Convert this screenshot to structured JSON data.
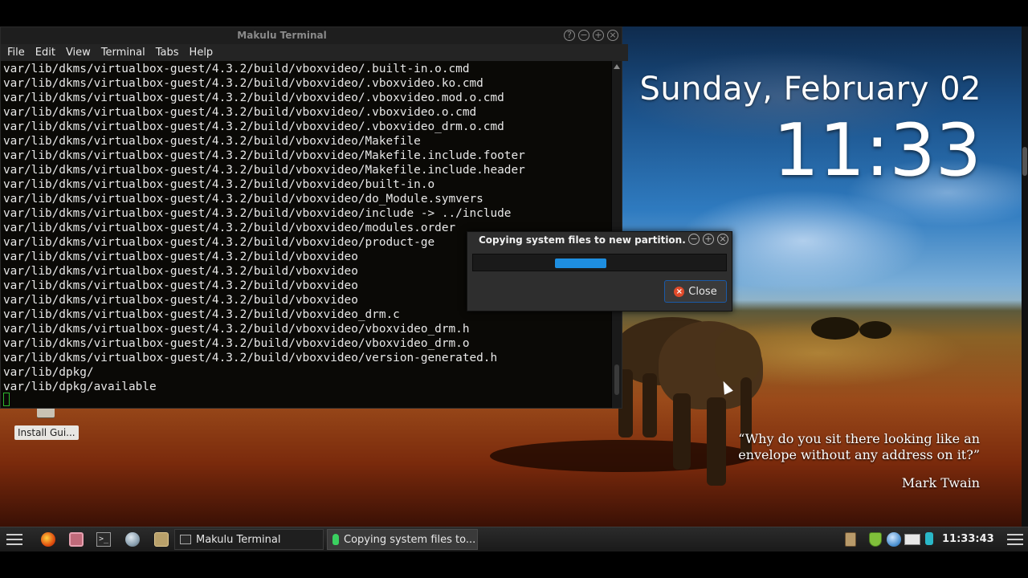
{
  "desktop": {
    "clock_date": "Sunday, February 02",
    "clock_time": "11:33",
    "quote_text": "“Why do you sit there looking like an envelope without any address on it?”",
    "quote_author": "Mark Twain",
    "icon_label": "Install Gui..."
  },
  "terminal": {
    "title": "Makulu Terminal",
    "menu": [
      "File",
      "Edit",
      "View",
      "Terminal",
      "Tabs",
      "Help"
    ],
    "lines": [
      "var/lib/dkms/virtualbox-guest/4.3.2/build/vboxvideo/.built-in.o.cmd",
      "var/lib/dkms/virtualbox-guest/4.3.2/build/vboxvideo/.vboxvideo.ko.cmd",
      "var/lib/dkms/virtualbox-guest/4.3.2/build/vboxvideo/.vboxvideo.mod.o.cmd",
      "var/lib/dkms/virtualbox-guest/4.3.2/build/vboxvideo/.vboxvideo.o.cmd",
      "var/lib/dkms/virtualbox-guest/4.3.2/build/vboxvideo/.vboxvideo_drm.o.cmd",
      "var/lib/dkms/virtualbox-guest/4.3.2/build/vboxvideo/Makefile",
      "var/lib/dkms/virtualbox-guest/4.3.2/build/vboxvideo/Makefile.include.footer",
      "var/lib/dkms/virtualbox-guest/4.3.2/build/vboxvideo/Makefile.include.header",
      "var/lib/dkms/virtualbox-guest/4.3.2/build/vboxvideo/built-in.o",
      "var/lib/dkms/virtualbox-guest/4.3.2/build/vboxvideo/do_Module.symvers",
      "var/lib/dkms/virtualbox-guest/4.3.2/build/vboxvideo/include -> ../include",
      "var/lib/dkms/virtualbox-guest/4.3.2/build/vboxvideo/modules.order",
      "var/lib/dkms/virtualbox-guest/4.3.2/build/vboxvideo/product-ge",
      "var/lib/dkms/virtualbox-guest/4.3.2/build/vboxvideo",
      "var/lib/dkms/virtualbox-guest/4.3.2/build/vboxvideo",
      "var/lib/dkms/virtualbox-guest/4.3.2/build/vboxvideo",
      "var/lib/dkms/virtualbox-guest/4.3.2/build/vboxvideo",
      "var/lib/dkms/virtualbox-guest/4.3.2/build/vboxvideo_drm.c",
      "var/lib/dkms/virtualbox-guest/4.3.2/build/vboxvideo/vboxvideo_drm.h",
      "var/lib/dkms/virtualbox-guest/4.3.2/build/vboxvideo/vboxvideo_drm.o",
      "var/lib/dkms/virtualbox-guest/4.3.2/build/vboxvideo/version-generated.h",
      "var/lib/dpkg/",
      "var/lib/dpkg/available"
    ]
  },
  "dialog": {
    "title": "Copying system files to new partition.",
    "close_label": "Close"
  },
  "taskbar": {
    "task_terminal": "Makulu Terminal",
    "task_copy": "Copying system files to...",
    "clock": "11:33:43"
  },
  "colors": {
    "progress": "#1e8ee0",
    "cursor": "#2eb82e"
  }
}
